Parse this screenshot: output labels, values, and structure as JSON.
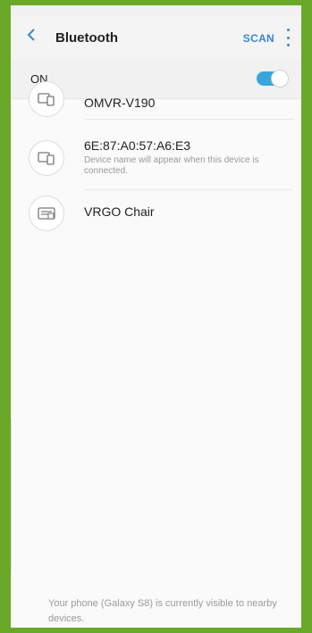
{
  "appbar": {
    "title": "Bluetooth",
    "scan_label": "SCAN"
  },
  "toggle_row": {
    "label": "ON",
    "enabled": true
  },
  "devices": [
    {
      "name": "OMVR-V190",
      "subtext": ""
    },
    {
      "name": "6E:87:A0:57:A6:E3",
      "subtext": "Device name will appear when this device is connected."
    },
    {
      "name": "VRGO Chair",
      "subtext": ""
    }
  ],
  "footer": {
    "text": "Your phone (Galaxy S8) is currently visible to nearby devices."
  },
  "colors": {
    "accent": "#3a86c8",
    "toggle_on": "#3ba6dc",
    "frame": "#6aa82a"
  }
}
